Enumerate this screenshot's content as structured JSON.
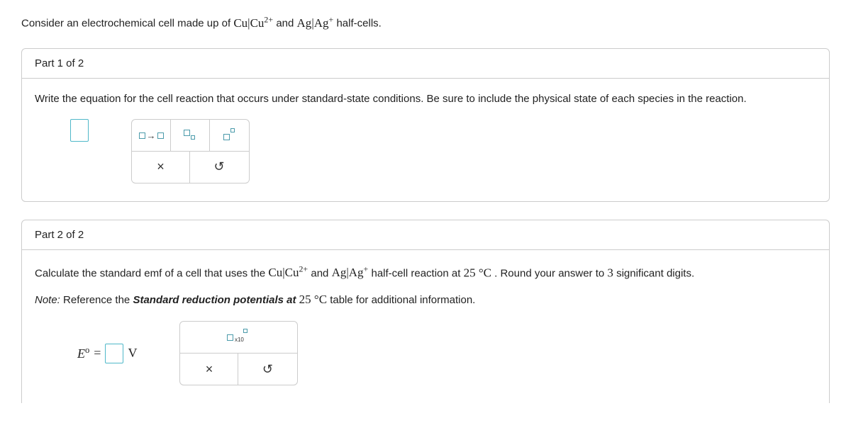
{
  "intro": {
    "prefix": "Consider an electrochemical cell made up of ",
    "cell1_a": "Cu",
    "cell1_b": "Cu",
    "cell1_charge": "2+",
    "mid": " and ",
    "cell2_a": "Ag",
    "cell2_b": "Ag",
    "cell2_charge": "+",
    "suffix": " half-cells."
  },
  "part1": {
    "header": "Part 1 of 2",
    "prompt": "Write the equation for the cell reaction that occurs under standard-state conditions. Be sure to include the physical state of each species in the reaction.",
    "tools": {
      "arrow": "→",
      "clear": "×",
      "reset": "↺"
    }
  },
  "part2": {
    "header": "Part 2 of 2",
    "prompt_prefix": "Calculate the standard emf of a cell that uses the ",
    "cell1_a": "Cu",
    "cell1_b": "Cu",
    "cell1_charge": "2+",
    "mid": " and ",
    "cell2_a": "Ag",
    "cell2_b": "Ag",
    "cell2_charge": "+",
    "prompt_mid2": " half-cell reaction at ",
    "temp": "25 °C",
    "prompt_suffix": ". Round your answer to ",
    "sigfig": "3",
    "prompt_end": " significant digits.",
    "note_prefix": "Note:",
    "note_mid": " Reference the ",
    "note_bold": "Standard reduction potentials at ",
    "note_temp": "25 °C",
    "note_suffix": " table for additional information.",
    "eq_symbol": "E",
    "eq_equals": "=",
    "eq_unit": "V",
    "tools": {
      "x10": "x10",
      "clear": "×",
      "reset": "↺"
    }
  }
}
